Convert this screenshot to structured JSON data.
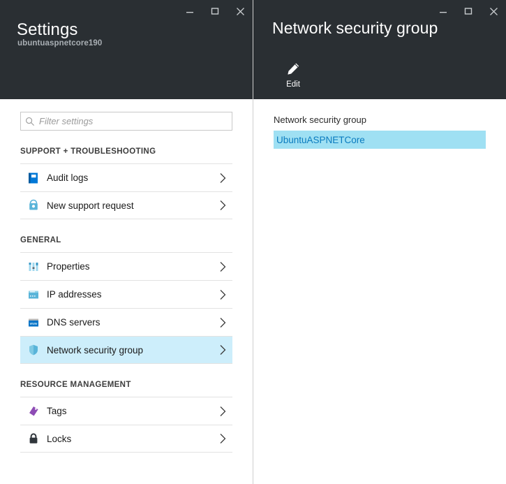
{
  "settings_blade": {
    "title": "Settings",
    "subtitle": "ubuntuaspnetcore190",
    "window_controls": [
      {
        "name": "minimize",
        "icon": "minimize-icon"
      },
      {
        "name": "maximize",
        "icon": "maximize-icon"
      },
      {
        "name": "close",
        "icon": "close-icon"
      }
    ],
    "filter": {
      "placeholder": "Filter settings",
      "value": "",
      "icon": "search-icon"
    },
    "sections": [
      {
        "title": "SUPPORT + TROUBLESHOOTING",
        "items": [
          {
            "label": "Audit logs",
            "icon": "audit-logs-icon",
            "selected": false
          },
          {
            "label": "New support request",
            "icon": "support-request-icon",
            "selected": false
          }
        ]
      },
      {
        "title": "GENERAL",
        "items": [
          {
            "label": "Properties",
            "icon": "properties-icon",
            "selected": false
          },
          {
            "label": "IP addresses",
            "icon": "ip-addresses-icon",
            "selected": false
          },
          {
            "label": "DNS servers",
            "icon": "dns-servers-icon",
            "selected": false
          },
          {
            "label": "Network security group",
            "icon": "shield-icon",
            "selected": true
          }
        ]
      },
      {
        "title": "RESOURCE MANAGEMENT",
        "items": [
          {
            "label": "Tags",
            "icon": "tag-icon",
            "selected": false
          },
          {
            "label": "Locks",
            "icon": "lock-icon",
            "selected": false
          }
        ]
      }
    ]
  },
  "nsg_blade": {
    "title": "Network security group",
    "window_controls": [
      {
        "name": "minimize",
        "icon": "minimize-icon"
      },
      {
        "name": "maximize",
        "icon": "maximize-icon"
      },
      {
        "name": "close",
        "icon": "close-icon"
      }
    ],
    "commands": [
      {
        "label": "Edit",
        "icon": "pencil-icon"
      }
    ],
    "content": {
      "label": "Network security group",
      "selected_value": "UbuntuASPNETCore"
    }
  },
  "colors": {
    "header_background": "#2a2f33",
    "selected_row": "#cdeefb",
    "selected_value_background": "#9fe0f3",
    "link": "#0a7bbf",
    "divider": "#e2e2e2"
  }
}
